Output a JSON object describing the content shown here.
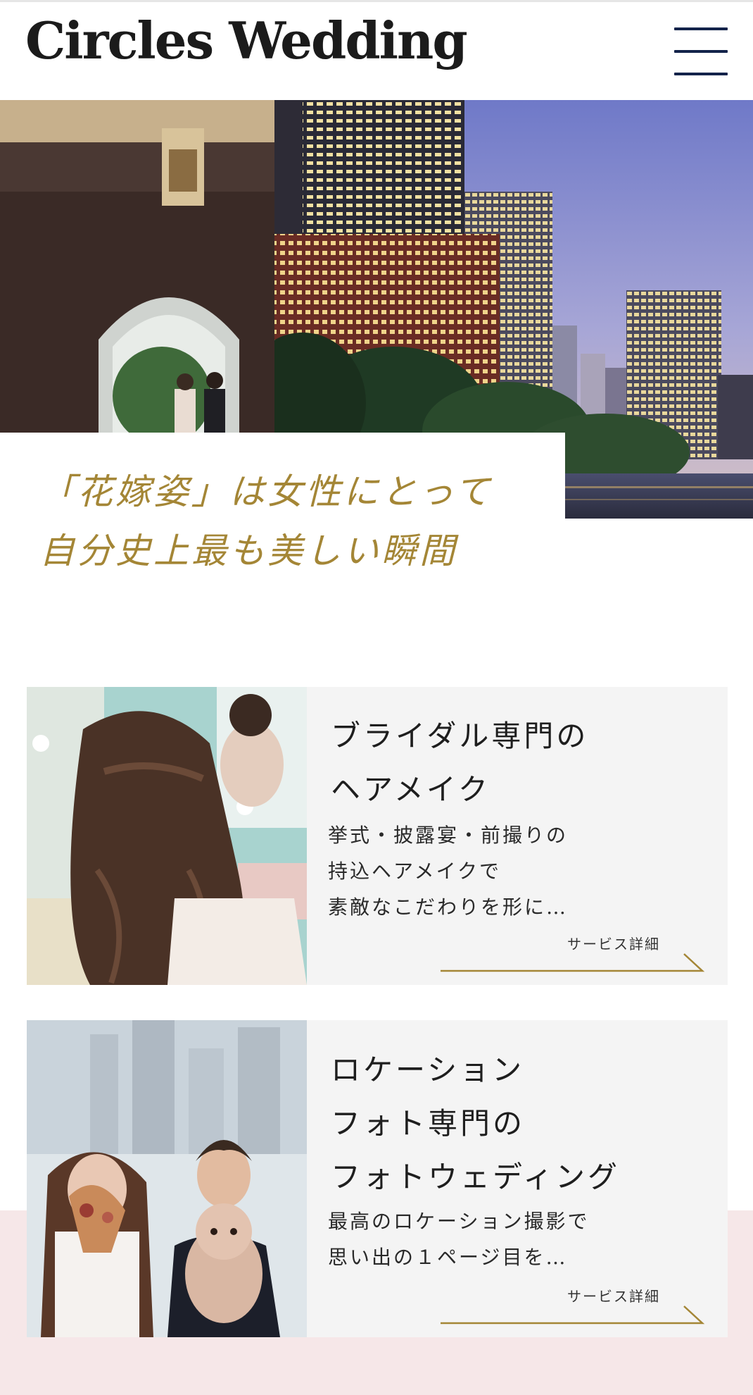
{
  "header": {
    "logo_text": "Circles Wedding",
    "menu_icon": "hamburger-menu-icon"
  },
  "hero": {
    "caption_line1": "「花嫁姿」は女性にとって",
    "caption_line2": "自分史上最も美しい瞬間",
    "accent_color": "#a48636"
  },
  "services": [
    {
      "title_lines": [
        "ブライダル専門の",
        "ヘアメイク"
      ],
      "desc_lines": [
        "挙式・披露宴・前撮りの",
        "持込ヘアメイクで",
        "素敵なこだわりを形に…"
      ],
      "link_label": "サービス詳細"
    },
    {
      "title_lines": [
        "ロケーション",
        "フォト専門の",
        "フォトウェディング"
      ],
      "desc_lines": [
        "最高のロケーション撮影で",
        "思い出の１ページ目を…"
      ],
      "link_label": "サービス詳細"
    }
  ],
  "colors": {
    "navy": "#13234a",
    "gold": "#a48636",
    "card_bg": "#f4f4f4",
    "pink_bg": "#f6e7e8"
  }
}
